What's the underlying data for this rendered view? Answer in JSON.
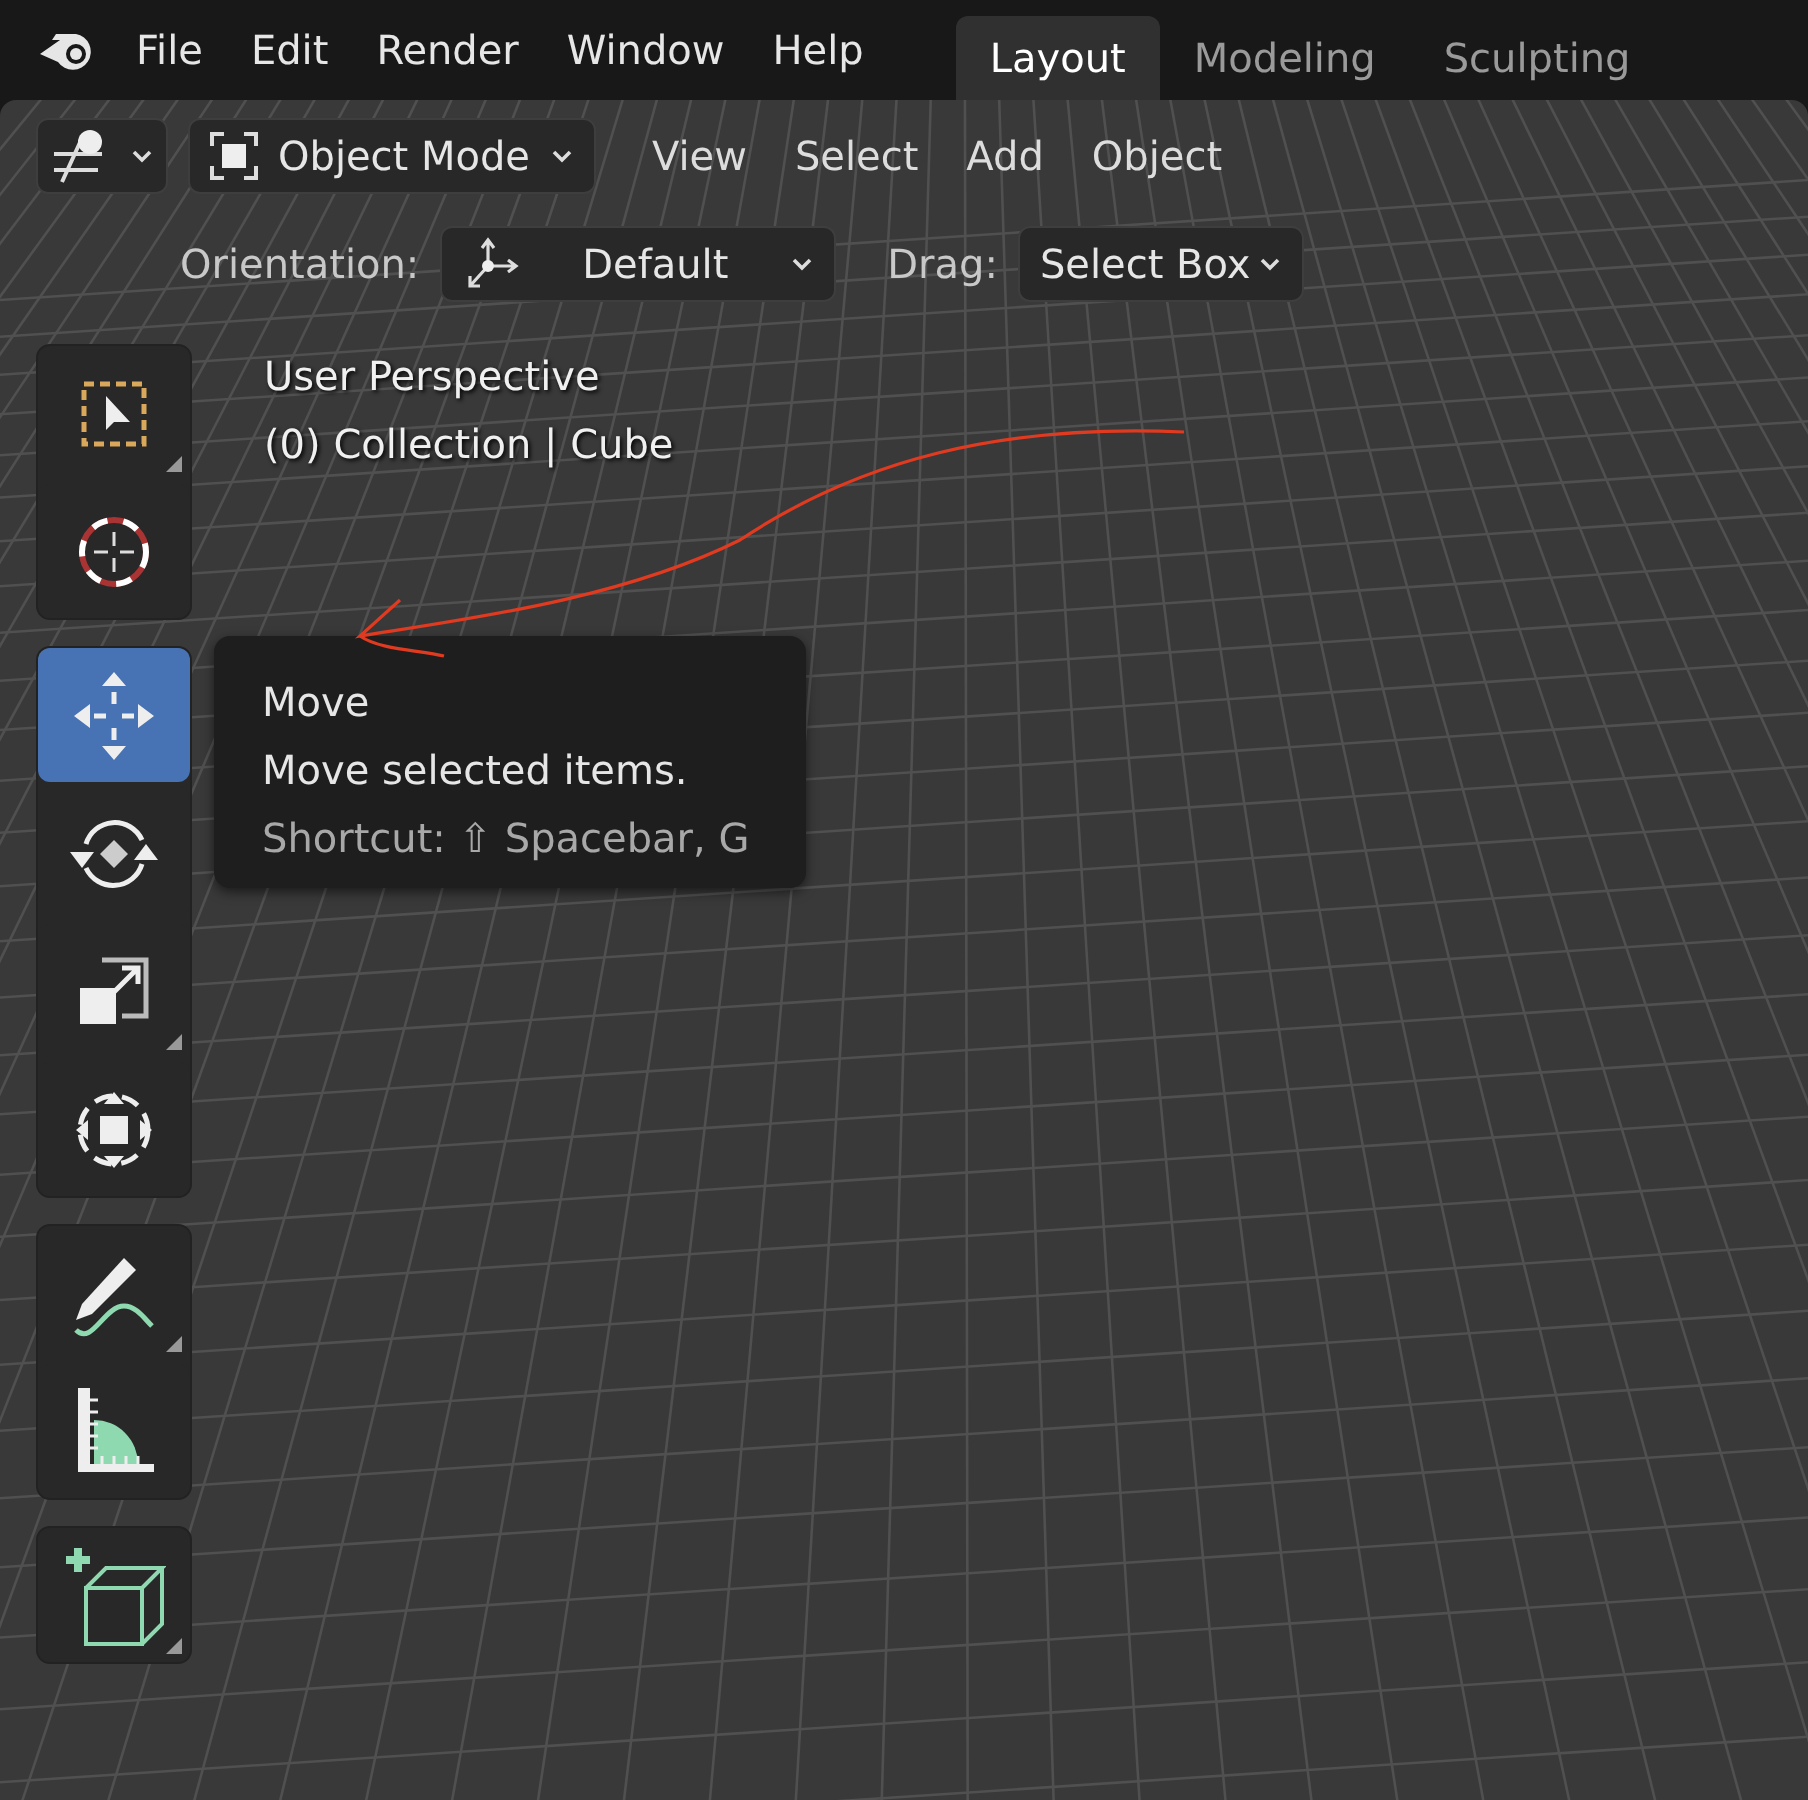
{
  "menu": [
    "File",
    "Edit",
    "Render",
    "Window",
    "Help"
  ],
  "workspace_tabs": [
    {
      "label": "Layout",
      "selected": true
    },
    {
      "label": "Modeling",
      "selected": false
    },
    {
      "label": "Sculpting",
      "selected": false
    }
  ],
  "header": {
    "mode": "Object Mode",
    "menus": [
      "View",
      "Select",
      "Add",
      "Object"
    ],
    "orientation_label": "Orientation:",
    "orientation": "Default",
    "drag_label": "Drag:",
    "drag": "Select Box"
  },
  "overlay": {
    "view": "User Perspective",
    "collection": "(0) Collection | Cube"
  },
  "tool_groups": [
    [
      {
        "kind": "select-box",
        "selected": false,
        "has_submenu": true
      },
      {
        "kind": "cursor",
        "selected": false,
        "has_submenu": false
      }
    ],
    [
      {
        "kind": "move",
        "selected": true,
        "has_submenu": false
      },
      {
        "kind": "rotate",
        "selected": false,
        "has_submenu": false
      },
      {
        "kind": "scale",
        "selected": false,
        "has_submenu": true
      },
      {
        "kind": "transform",
        "selected": false,
        "has_submenu": false
      }
    ],
    [
      {
        "kind": "annotate",
        "selected": false,
        "has_submenu": true
      },
      {
        "kind": "measure",
        "selected": false,
        "has_submenu": false
      }
    ],
    [
      {
        "kind": "add-cube",
        "selected": false,
        "has_submenu": true
      }
    ]
  ],
  "tooltip": {
    "title": "Move",
    "description": "Move selected items.",
    "shortcut": "Shortcut: ⇧ Spacebar, G"
  }
}
